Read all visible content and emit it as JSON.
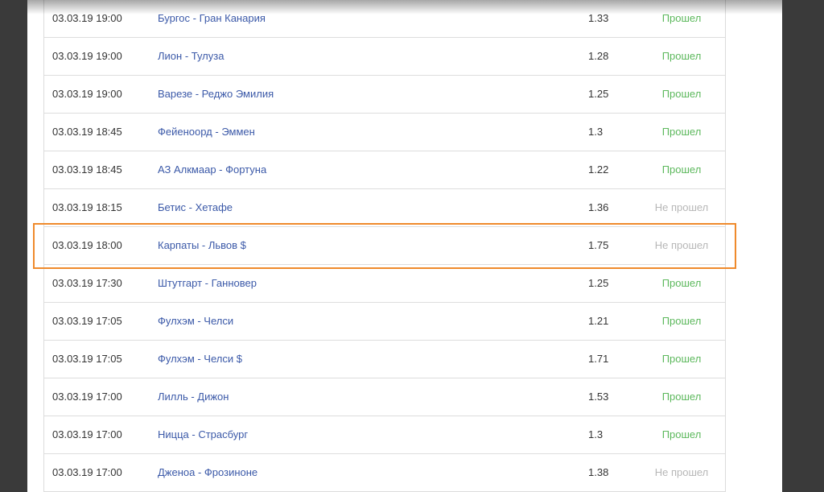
{
  "colors": {
    "link": "#3b59a8",
    "status_pass": "#5cb85c",
    "status_fail": "#b7b7b7",
    "highlight": "#ef8a2c"
  },
  "rows": [
    {
      "datetime": "03.03.19 19:00",
      "match": "Бургос - Гран Канария",
      "odds": "1.33",
      "status": "Прошел",
      "passed": true
    },
    {
      "datetime": "03.03.19 19:00",
      "match": "Лион - Тулуза",
      "odds": "1.28",
      "status": "Прошел",
      "passed": true
    },
    {
      "datetime": "03.03.19 19:00",
      "match": "Варезе - Реджо Эмилия",
      "odds": "1.25",
      "status": "Прошел",
      "passed": true
    },
    {
      "datetime": "03.03.19 18:45",
      "match": "Фейеноорд - Эммен",
      "odds": "1.3",
      "status": "Прошел",
      "passed": true
    },
    {
      "datetime": "03.03.19 18:45",
      "match": "АЗ Алкмаар - Фортуна",
      "odds": "1.22",
      "status": "Прошел",
      "passed": true
    },
    {
      "datetime": "03.03.19 18:15",
      "match": "Бетис - Хетафе",
      "odds": "1.36",
      "status": "Не прошел",
      "passed": false
    },
    {
      "datetime": "03.03.19 18:00",
      "match": "Карпаты - Львов $",
      "odds": "1.75",
      "status": "Не прошел",
      "passed": false,
      "highlighted": true
    },
    {
      "datetime": "03.03.19 17:30",
      "match": "Штутгарт - Ганновер",
      "odds": "1.25",
      "status": "Прошел",
      "passed": true
    },
    {
      "datetime": "03.03.19 17:05",
      "match": "Фулхэм - Челси",
      "odds": "1.21",
      "status": "Прошел",
      "passed": true
    },
    {
      "datetime": "03.03.19 17:05",
      "match": "Фулхэм - Челси $",
      "odds": "1.71",
      "status": "Прошел",
      "passed": true
    },
    {
      "datetime": "03.03.19 17:00",
      "match": "Лилль - Дижон",
      "odds": "1.53",
      "status": "Прошел",
      "passed": true
    },
    {
      "datetime": "03.03.19 17:00",
      "match": "Ницца - Страсбург",
      "odds": "1.3",
      "status": "Прошел",
      "passed": true
    },
    {
      "datetime": "03.03.19 17:00",
      "match": "Дженоа - Фрозиноне",
      "odds": "1.38",
      "status": "Не прошел",
      "passed": false
    }
  ]
}
